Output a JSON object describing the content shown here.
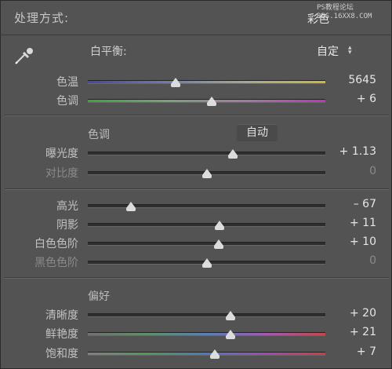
{
  "header": {
    "title": "处理方式:",
    "mode": "彩色",
    "watermark_line1": "PS教程论坛",
    "watermark_line2": "BBS.16XX8.COM"
  },
  "white_balance": {
    "label": "白平衡:",
    "value": "自定",
    "arrows": "⌃⌄"
  },
  "tone": {
    "label": "色调",
    "auto_label": "自动"
  },
  "presence": {
    "label": "偏好"
  },
  "sliders": {
    "temp": {
      "label": "色温",
      "value": "5645",
      "position": 0.37
    },
    "tint": {
      "label": "色调",
      "value": "+ 6",
      "position": 0.52
    },
    "exposure": {
      "label": "曝光度",
      "value": "+ 1.13",
      "position": 0.61
    },
    "contrast": {
      "label": "对比度",
      "value": "0",
      "position": 0.5
    },
    "highlights": {
      "label": "高光",
      "value": "– 67",
      "position": 0.18
    },
    "shadows": {
      "label": "阴影",
      "value": "+ 11",
      "position": 0.555
    },
    "whites": {
      "label": "白色色阶",
      "value": "+ 10",
      "position": 0.55
    },
    "blacks": {
      "label": "黑色色阶",
      "value": "0",
      "position": 0.5
    },
    "clarity": {
      "label": "清晰度",
      "value": "+ 20",
      "position": 0.6
    },
    "vibrance": {
      "label": "鲜艳度",
      "value": "+ 21",
      "position": 0.6
    },
    "saturation": {
      "label": "饱和度",
      "value": "+ 7",
      "position": 0.535
    }
  }
}
